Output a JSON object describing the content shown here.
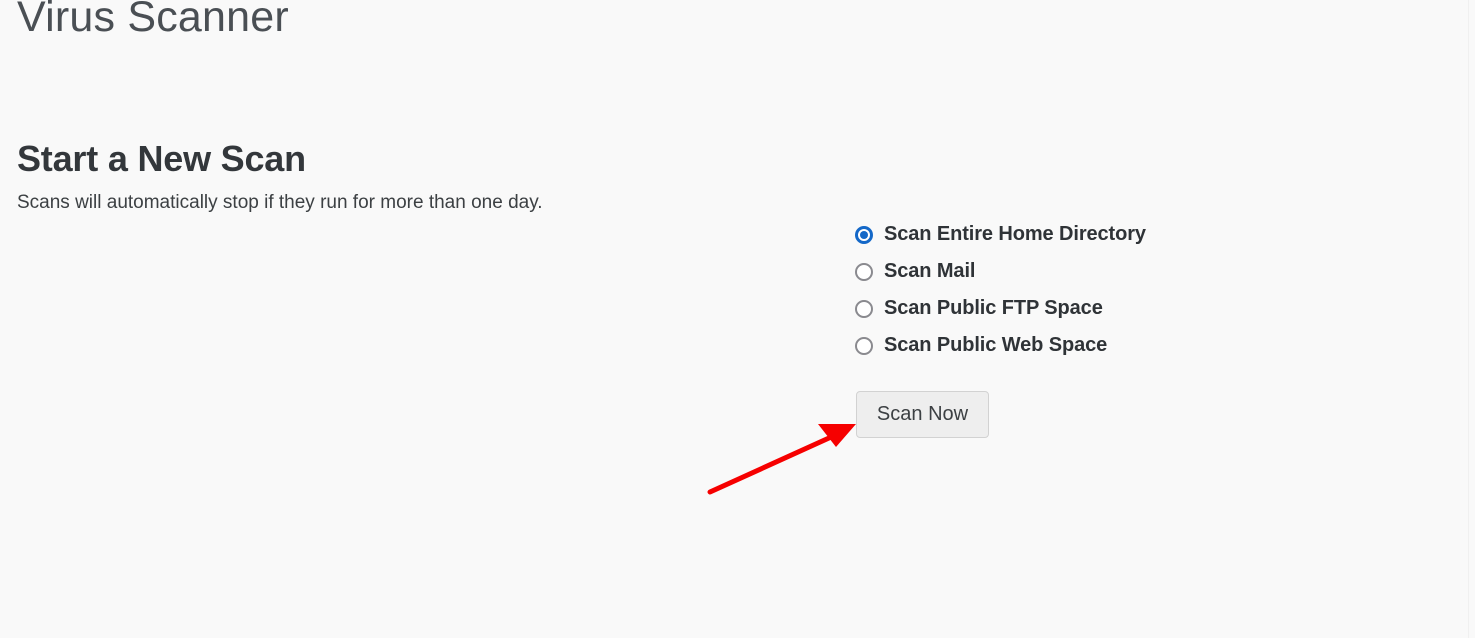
{
  "app": {
    "title": "Virus Scanner",
    "background_color": "#f9f9f9"
  },
  "section": {
    "heading": "Start a New Scan",
    "subtitle": "Scans will automatically stop if they run for more than one day."
  },
  "scan_form": {
    "selected_value": "home",
    "options": [
      {
        "value": "home",
        "label": "Scan Entire Home Directory",
        "selected": true
      },
      {
        "value": "mail",
        "label": "Scan Mail",
        "selected": false
      },
      {
        "value": "ftp",
        "label": "Scan Public FTP Space",
        "selected": false
      },
      {
        "value": "web",
        "label": "Scan Public Web Space",
        "selected": false
      }
    ],
    "submit_label": "Scan Now",
    "accent_color": "#1468c8",
    "radio_unselected_color": "#8a8a8f"
  },
  "annotation": {
    "type": "arrow",
    "color": "#f60000",
    "points_to": "Scan Now"
  }
}
